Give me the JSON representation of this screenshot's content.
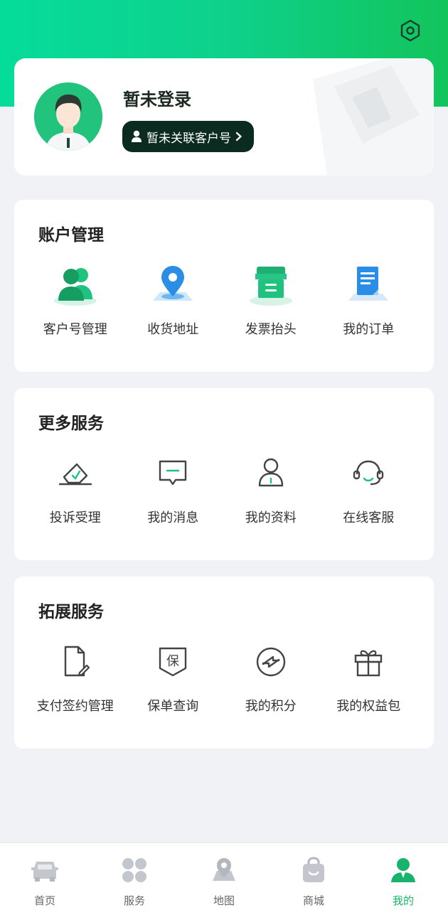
{
  "profile": {
    "login_status": "暂未登录",
    "link_button": "暂未关联客户号"
  },
  "colors": {
    "brand_green": "#12c45b",
    "accent_mint": "#06dc9a",
    "dark_button": "#0b2b20",
    "tab_active": "#18b36c"
  },
  "sections": [
    {
      "title": "账户管理",
      "items": [
        {
          "label": "客户号管理",
          "icon": "users-icon"
        },
        {
          "label": "收货地址",
          "icon": "location-pin-icon"
        },
        {
          "label": "发票抬头",
          "icon": "invoice-box-icon"
        },
        {
          "label": "我的订单",
          "icon": "order-document-icon"
        }
      ]
    },
    {
      "title": "更多服务",
      "items": [
        {
          "label": "投诉受理",
          "icon": "complaint-icon"
        },
        {
          "label": "我的消息",
          "icon": "message-icon"
        },
        {
          "label": "我的资料",
          "icon": "profile-icon"
        },
        {
          "label": "在线客服",
          "icon": "headset-icon"
        }
      ]
    },
    {
      "title": "拓展服务",
      "items": [
        {
          "label": "支付签约管理",
          "icon": "sign-document-icon"
        },
        {
          "label": "保单查询",
          "icon": "policy-shield-icon",
          "glyph": "保"
        },
        {
          "label": "我的积分",
          "icon": "points-icon"
        },
        {
          "label": "我的权益包",
          "icon": "gift-icon"
        }
      ]
    }
  ],
  "tabbar": {
    "items": [
      {
        "label": "首页",
        "icon": "car-icon",
        "active": false
      },
      {
        "label": "服务",
        "icon": "grid-icon",
        "active": false
      },
      {
        "label": "地图",
        "icon": "map-icon",
        "active": false
      },
      {
        "label": "商城",
        "icon": "shopping-bag-icon",
        "active": false
      },
      {
        "label": "我的",
        "icon": "person-icon",
        "active": true
      }
    ]
  }
}
